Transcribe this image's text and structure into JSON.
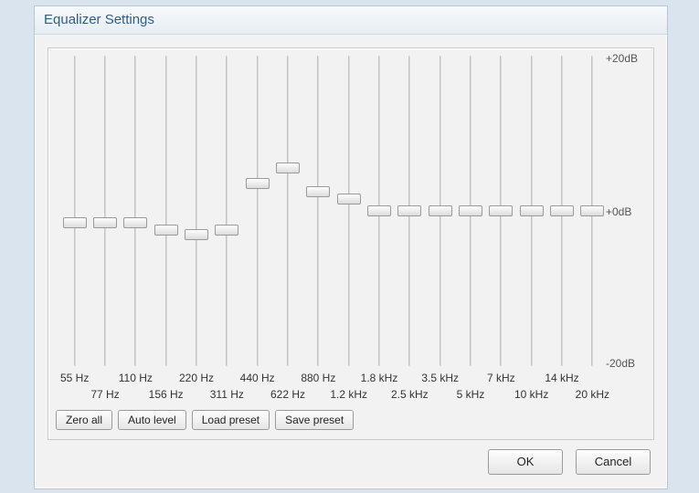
{
  "title": "Equalizer Settings",
  "db": {
    "max": "+20dB",
    "zero": "+0dB",
    "min": "-20dB"
  },
  "bands": [
    {
      "freq": "55 Hz",
      "gain": -1.5
    },
    {
      "freq": "77 Hz",
      "gain": -1.5
    },
    {
      "freq": "110 Hz",
      "gain": -1.5
    },
    {
      "freq": "156 Hz",
      "gain": -2.5
    },
    {
      "freq": "220 Hz",
      "gain": -3.0
    },
    {
      "freq": "311 Hz",
      "gain": -2.5
    },
    {
      "freq": "440 Hz",
      "gain": 3.5
    },
    {
      "freq": "622 Hz",
      "gain": 5.5
    },
    {
      "freq": "880 Hz",
      "gain": 2.5
    },
    {
      "freq": "1.2 kHz",
      "gain": 1.5
    },
    {
      "freq": "1.8 kHz",
      "gain": 0.0
    },
    {
      "freq": "2.5 kHz",
      "gain": 0.0
    },
    {
      "freq": "3.5 kHz",
      "gain": 0.0
    },
    {
      "freq": "5 kHz",
      "gain": 0.0
    },
    {
      "freq": "7 kHz",
      "gain": 0.0
    },
    {
      "freq": "10 kHz",
      "gain": 0.0
    },
    {
      "freq": "14 kHz",
      "gain": 0.0
    },
    {
      "freq": "20 kHz",
      "gain": 0.0
    }
  ],
  "buttons": {
    "zero_all": "Zero all",
    "auto_level": "Auto level",
    "load_preset": "Load preset",
    "save_preset": "Save preset",
    "ok": "OK",
    "cancel": "Cancel"
  }
}
